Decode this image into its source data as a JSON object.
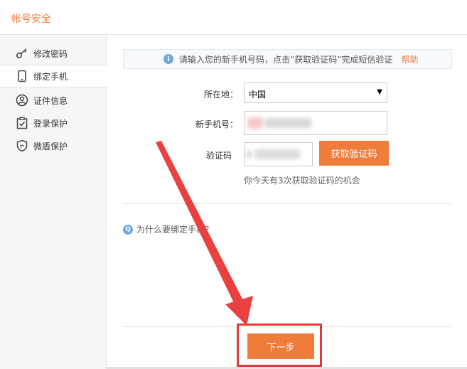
{
  "header": {
    "title": "帐号安全"
  },
  "sidebar": {
    "items": [
      {
        "label": "修改密码",
        "icon": "key-icon",
        "active": false
      },
      {
        "label": "绑定手机",
        "icon": "phone-icon",
        "active": true
      },
      {
        "label": "证件信息",
        "icon": "user-circle-icon",
        "active": false
      },
      {
        "label": "登录保护",
        "icon": "clipboard-check-icon",
        "active": false
      },
      {
        "label": "微盾保护",
        "icon": "shield-icon",
        "active": false
      }
    ]
  },
  "notice": {
    "icon": "info-icon",
    "message": "请输入您的新手机号码，点击“获取验证码”完成短信验证",
    "help": "帮助"
  },
  "form": {
    "region_label": "所在地：",
    "region_value": "中国",
    "phone_label": "新手机号：",
    "code_label": "验证码",
    "get_code_button": "获取验证码",
    "hint": "你今天有3次获取验证码的机会"
  },
  "why": {
    "icon": "question-icon",
    "text": "为什么要绑定手机？"
  },
  "next_button": "下一步",
  "colors": {
    "accent": "#f07c3c",
    "annotation_red": "#e03a3a",
    "info_blue": "#6fa8dc"
  }
}
